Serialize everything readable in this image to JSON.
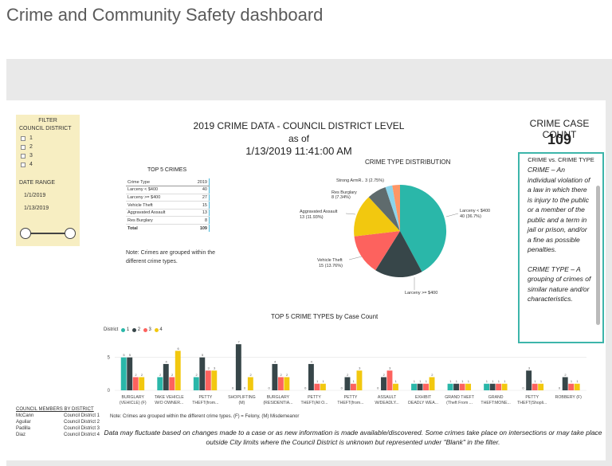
{
  "page": {
    "title": "Crime and Community Safety dashboard"
  },
  "filter": {
    "title": "FILTER",
    "council_label": "COUNCIL DISTRICT",
    "districts": [
      "1",
      "2",
      "3",
      "4"
    ],
    "date_label": "DATE RANGE",
    "date_start": "1/1/2019",
    "date_end": "1/13/2019"
  },
  "report": {
    "title_line1": "2019 CRIME DATA - COUNCIL DISTRICT LEVEL as of",
    "title_line2": "1/13/2019 11:41:00 AM"
  },
  "top5": {
    "title": "TOP 5 CRIMES",
    "col_type": "Crime Type",
    "col_year": "2019",
    "rows": [
      {
        "type": "Larceny < $400",
        "count": "40"
      },
      {
        "type": "Larceny >= $400",
        "count": "27"
      },
      {
        "type": "Vehicle Theft",
        "count": "15"
      },
      {
        "type": "Aggravated Assault",
        "count": "13"
      },
      {
        "type": "Res Burglary",
        "count": "8"
      }
    ],
    "total_label": "Total",
    "total_value": "109",
    "note": "Note: Crimes are grouped within the different crime types."
  },
  "distribution": {
    "title": "CRIME TYPE DISTRIBUTION",
    "labels": {
      "larceny_lt": [
        "Larceny < $400",
        "40 (36.7%)"
      ],
      "larceny_ge": [
        "Larceny >= $400"
      ],
      "vehicle": [
        "Vehicle Theft",
        "15 (13.76%)"
      ],
      "assault": [
        "Aggravated Assault",
        "13 (11.93%)"
      ],
      "burglary": [
        "Res Burglary",
        "8 (7.34%)"
      ],
      "robbery": [
        "Strong ArmR.. 3 (2.75%)"
      ]
    }
  },
  "case_count": {
    "title": "CRIME CASE COUNT",
    "value": "109",
    "def_header": "CRIME vs. CRIME TYPE",
    "def_crime": "CRIME – An individual violation of a law in which there is injury to the public or a member of the public and a term in jail or prison, and/or a fine as possible penalties.",
    "def_type": "CRIME TYPE – A grouping of crimes of similar nature and/or characteristics."
  },
  "bar_chart": {
    "title": "TOP 5 CRIME TYPES by Case Count",
    "legend_label": "District",
    "note": "Note: Crimes are grouped within the different crime types.  (F) = Felony, (M) Misdemeanor"
  },
  "chart_data": {
    "type": "bar",
    "title": "TOP 5 CRIME TYPES by Case Count",
    "legend_title": "District",
    "legend_position": "top-left",
    "categories": [
      [
        "BURGLARY",
        "(VEHICLE) (F)"
      ],
      [
        "TAKE VEHICLE",
        "W/O OWNER..."
      ],
      [
        "PETTY",
        "THEFT(from..."
      ],
      [
        "SHOPLIFTING",
        "(M)"
      ],
      [
        "BURGLARY",
        "(RESIDENTIA..."
      ],
      [
        "PETTY",
        "THEFT(All O..."
      ],
      [
        "PETTY",
        "THEFT(from..."
      ],
      [
        "ASSAULT",
        "W/DEADLY..."
      ],
      [
        "EXHIBIT",
        "DEADLY WEA..."
      ],
      [
        "GRAND THEFT",
        "(Theft From ..."
      ],
      [
        "GRAND",
        "THEFT:MONE..."
      ],
      [
        "PETTY",
        "THEFT(Shopli..."
      ],
      [
        "ROBBERY (F)",
        ""
      ]
    ],
    "series": [
      {
        "name": "1",
        "color": "#2ab7a9",
        "values": [
          5,
          2,
          2,
          0,
          0,
          0,
          0,
          0,
          1,
          1,
          1,
          0,
          0
        ]
      },
      {
        "name": "2",
        "color": "#374649",
        "values": [
          5,
          4,
          5,
          7,
          4,
          4,
          2,
          2,
          1,
          1,
          1,
          3,
          2
        ]
      },
      {
        "name": "3",
        "color": "#fd625e",
        "values": [
          2,
          2,
          3,
          0,
          2,
          1,
          1,
          3,
          1,
          1,
          1,
          1,
          1
        ]
      },
      {
        "name": "4",
        "color": "#f2c80f",
        "values": [
          2,
          6,
          3,
          2,
          2,
          1,
          3,
          1,
          2,
          1,
          1,
          1,
          1
        ]
      }
    ],
    "yticks": [
      0,
      5
    ],
    "ylim": [
      0,
      7.5
    ]
  },
  "members": {
    "title": "COUNCIL MEMBERS BY DISTRICT",
    "rows": [
      {
        "name": "McCann",
        "district": "Council District 1"
      },
      {
        "name": "Aguilar",
        "district": "Council District 2"
      },
      {
        "name": "Padilla",
        "district": "Council District 3"
      },
      {
        "name": "Diaz",
        "district": "Council District 4"
      }
    ]
  },
  "disclaimer": "Data may fluctuate based on changes made to a case or as new information is made available/discovered. Some crimes take place on intersections or may take place outside City limits where the Council District is unknown but represented under \"Blank\" in the filter."
}
